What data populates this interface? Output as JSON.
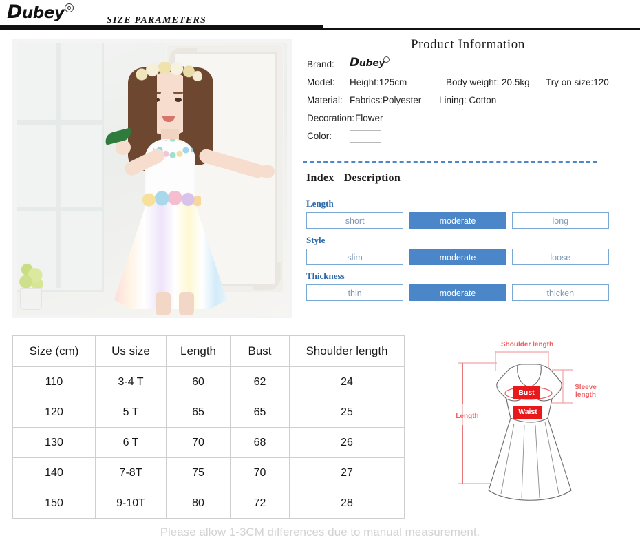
{
  "header": {
    "logo_prefix": "D",
    "logo_rest": "ubey",
    "logo_mark": "spiral-icon",
    "title": "SIZE  PARAMETERS"
  },
  "photo": {
    "alt": "girl-in-rainbow-tulle-dress-photo"
  },
  "product_info": {
    "title": "Product  Information",
    "brand_label": "Brand:",
    "brand_logo_prefix": "D",
    "brand_logo_rest": "ubey",
    "model_label": "Model:",
    "model_height": "Height:125cm",
    "model_weight": "Body weight: 20.5kg",
    "model_tryon": "Try on size:120",
    "material_label": "Material:",
    "material_fabrics": "Fabrics:Polyester",
    "material_lining": "Lining: Cotton",
    "decoration_label": "Decoration:",
    "decoration_value": "Flower",
    "color_label": "Color:",
    "color_swatch_hex": "#ffffff"
  },
  "index_section": {
    "heading_index": "Index",
    "heading_description": "Description",
    "divider_color": "#4f86c6",
    "selected_color": "#4a86c8",
    "groups": [
      {
        "label": "Length",
        "options": [
          {
            "text": "short",
            "selected": false
          },
          {
            "text": "moderate",
            "selected": true
          },
          {
            "text": "long",
            "selected": false
          }
        ]
      },
      {
        "label": "Style",
        "options": [
          {
            "text": "slim",
            "selected": false
          },
          {
            "text": "moderate",
            "selected": true
          },
          {
            "text": "loose",
            "selected": false
          }
        ]
      },
      {
        "label": "Thickness",
        "options": [
          {
            "text": "thin",
            "selected": false
          },
          {
            "text": "moderate",
            "selected": true
          },
          {
            "text": "thicken",
            "selected": false
          }
        ]
      }
    ]
  },
  "size_table": {
    "headers": [
      "Size (cm)",
      "Us size",
      "Length",
      "Bust",
      "Shoulder length"
    ],
    "rows": [
      [
        "110",
        "3-4 T",
        "60",
        "62",
        "24"
      ],
      [
        "120",
        "5 T",
        "65",
        "65",
        "25"
      ],
      [
        "130",
        "6 T",
        "70",
        "68",
        "26"
      ],
      [
        "140",
        "7-8T",
        "75",
        "70",
        "27"
      ],
      [
        "150",
        "9-10T",
        "80",
        "72",
        "28"
      ]
    ]
  },
  "diagram": {
    "labels": {
      "shoulder": "Shoulder length",
      "sleeve": "Sleeve length",
      "length": "Length",
      "bust": "Bust",
      "waist": "Waist"
    },
    "accent_color": "#ef5f63",
    "box_color": "#e8191b"
  },
  "footer": {
    "note": "Please allow 1-3CM differences due to manual measurement."
  }
}
